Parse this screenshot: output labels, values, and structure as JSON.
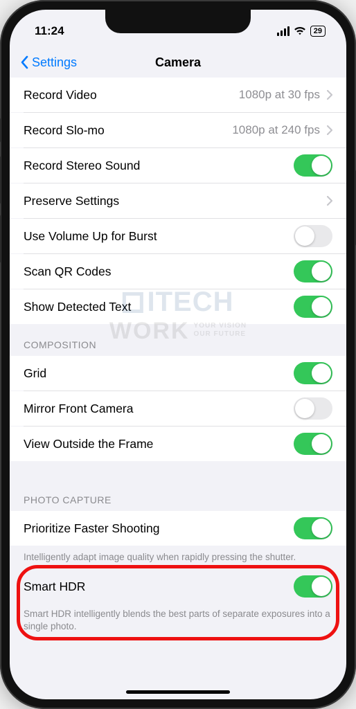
{
  "status": {
    "time": "11:24",
    "battery": "29"
  },
  "nav": {
    "back": "Settings",
    "title": "Camera"
  },
  "rows": {
    "record_video": {
      "label": "Record Video",
      "value": "1080p at 30 fps"
    },
    "record_slomo": {
      "label": "Record Slo-mo",
      "value": "1080p at 240 fps"
    },
    "stereo": {
      "label": "Record Stereo Sound",
      "on": true
    },
    "preserve": {
      "label": "Preserve Settings"
    },
    "volume_burst": {
      "label": "Use Volume Up for Burst",
      "on": false
    },
    "scan_qr": {
      "label": "Scan QR Codes",
      "on": true
    },
    "detected_text": {
      "label": "Show Detected Text",
      "on": true
    },
    "grid": {
      "label": "Grid",
      "on": true
    },
    "mirror": {
      "label": "Mirror Front Camera",
      "on": false
    },
    "outside_frame": {
      "label": "View Outside the Frame",
      "on": true
    },
    "prioritize": {
      "label": "Prioritize Faster Shooting",
      "on": true
    },
    "smart_hdr": {
      "label": "Smart HDR",
      "on": true
    }
  },
  "sections": {
    "composition": "COMPOSITION",
    "photo_capture": "PHOTO CAPTURE"
  },
  "footers": {
    "prioritize": "Intelligently adapt image quality when rapidly pressing the shutter.",
    "smart_hdr": "Smart HDR intelligently blends the best parts of separate exposures into a single photo."
  },
  "watermark": {
    "line1": "ITECH",
    "line2": "WORK",
    "t1": "YOUR VISION",
    "t2": "OUR FUTURE"
  }
}
